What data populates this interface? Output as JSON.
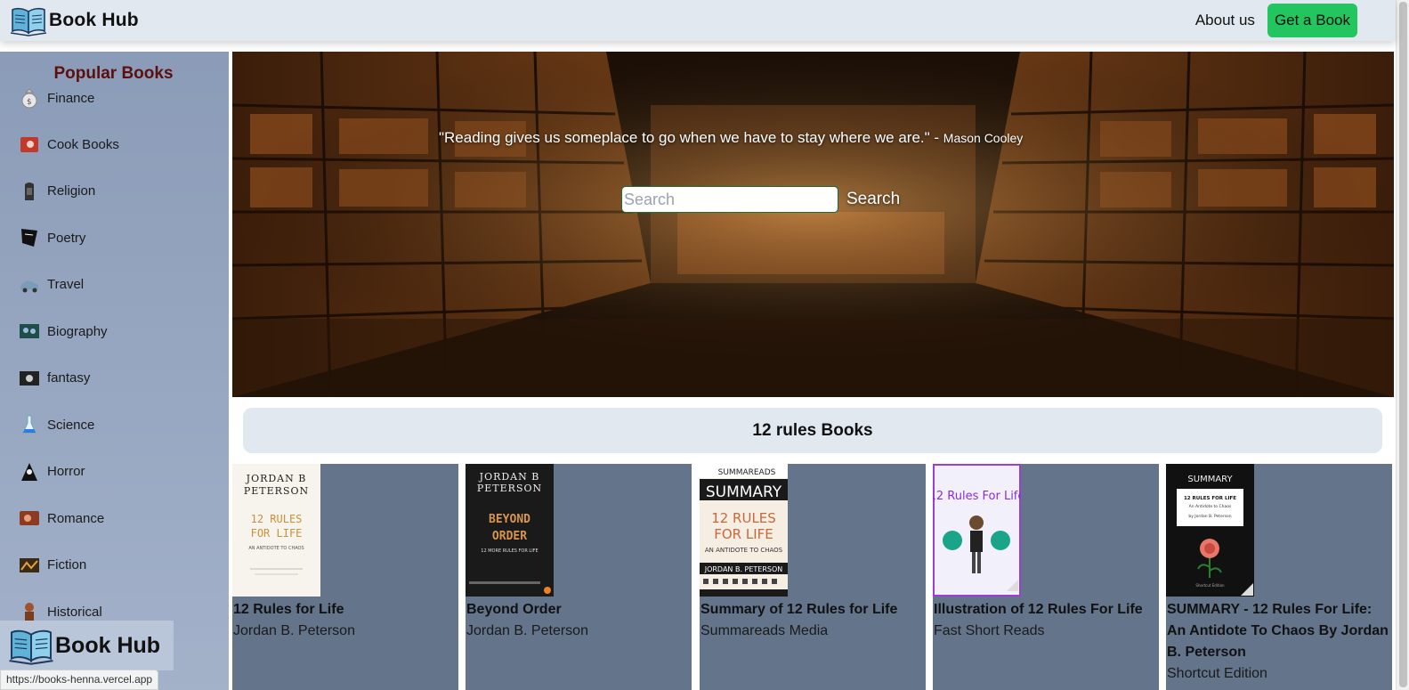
{
  "navbar": {
    "brand": "Book Hub",
    "about_label": "About us",
    "get_book_label": "Get a Book"
  },
  "sidebar": {
    "title": "Popular Books",
    "items": [
      {
        "label": "Finance",
        "icon": "money-bag-icon"
      },
      {
        "label": "Cook Books",
        "icon": "cookbook-icon"
      },
      {
        "label": "Religion",
        "icon": "religion-icon"
      },
      {
        "label": "Poetry",
        "icon": "poetry-icon"
      },
      {
        "label": "Travel",
        "icon": "travel-icon"
      },
      {
        "label": "Biography",
        "icon": "biography-icon"
      },
      {
        "label": "fantasy",
        "icon": "fantasy-icon"
      },
      {
        "label": "Science",
        "icon": "science-flask-icon"
      },
      {
        "label": "Horror",
        "icon": "horror-icon"
      },
      {
        "label": "Romance",
        "icon": "romance-icon"
      },
      {
        "label": "Fiction",
        "icon": "fiction-icon"
      },
      {
        "label": "Historical",
        "icon": "historical-icon"
      }
    ]
  },
  "floating_brand": "Book Hub",
  "status_url": "https://books-henna.vercel.app",
  "hero": {
    "quote": "\"Reading gives us someplace to go when we have to stay where we are.\" -",
    "author": "Mason Cooley",
    "search_placeholder": "Search",
    "search_value": "",
    "search_button": "Search"
  },
  "results": {
    "title": "12 rules Books",
    "books": [
      {
        "title": "12 Rules for Life",
        "author": "Jordan B. Peterson",
        "cover": [
          "JORDAN B",
          "PETERSON",
          "12 RULES",
          "FOR LIFE",
          "AN ANTIDOTE TO CHAOS"
        ]
      },
      {
        "title": "Beyond Order",
        "author": "Jordan B. Peterson",
        "cover": [
          "JORDAN B",
          "PETERSON",
          "BEYOND",
          "ORDER",
          "12 MORE RULES FOR LIFE"
        ]
      },
      {
        "title": "Summary of 12 Rules for Life",
        "author": "Summareads Media",
        "cover": [
          "SUMMAREADS",
          "SUMMARY",
          "12 RULES",
          "FOR LIFE",
          "AN ANTIDOTE TO CHAOS",
          "JORDAN B. PETERSON"
        ]
      },
      {
        "title": "Illustration of 12 Rules For Life",
        "author": "Fast Short Reads",
        "cover": [
          "12 Rules For Life"
        ]
      },
      {
        "title": "SUMMARY - 12 Rules For Life: An Antidote To Chaos By Jordan B. Peterson",
        "author": "Shortcut Edition",
        "cover": [
          "SUMMARY",
          "12 RULES FOR LIFE",
          "An Antidote to Chaos",
          "by Jordan B. Peterson",
          "Shortcut Edition"
        ]
      }
    ]
  },
  "colors": {
    "navbar_bg": "#e2e8f0",
    "accent_green": "#22c55e",
    "sidebar_title": "#5b1010",
    "card_bg": "#64748b"
  }
}
